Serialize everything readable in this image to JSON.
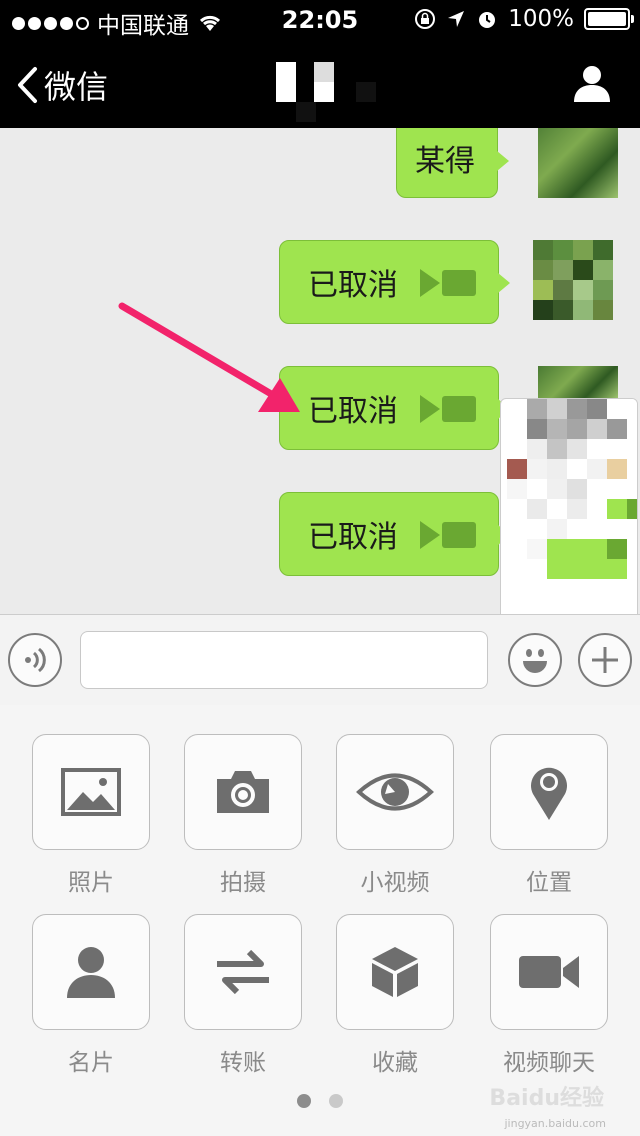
{
  "status_bar": {
    "carrier": "中国联通",
    "time": "22:05",
    "battery": "100%"
  },
  "nav": {
    "back_label": "微信",
    "icons": [
      "chevron-left-icon",
      "profile-icon"
    ]
  },
  "chat": {
    "messages": [
      {
        "text": "某得"
      },
      {
        "text": "已取消"
      },
      {
        "text": "已取消"
      },
      {
        "text": "已取消"
      }
    ]
  },
  "input_bar": {
    "icons": [
      "voice-icon",
      "emoji-icon",
      "plus-icon"
    ]
  },
  "panel": {
    "row1": [
      {
        "label": "照片",
        "icon": "photo-icon"
      },
      {
        "label": "拍摄",
        "icon": "camera-icon"
      },
      {
        "label": "小视频",
        "icon": "eye-icon"
      },
      {
        "label": "位置",
        "icon": "location-pin-icon"
      }
    ],
    "row2": [
      {
        "label": "名片",
        "icon": "person-card-icon"
      },
      {
        "label": "转账",
        "icon": "transfer-arrows-icon"
      },
      {
        "label": "收藏",
        "icon": "box-icon"
      },
      {
        "label": "视频聊天",
        "icon": "video-camera-icon"
      }
    ],
    "page_count": 2,
    "active_page": 1
  },
  "watermark": {
    "text": "Baidu经验",
    "sub": "jingyan.baidu.com"
  },
  "colors": {
    "bubble_green": "#9fe44f",
    "arrow_pink": "#f2236b",
    "chat_bg": "#ebebeb",
    "icon_gray": "#6e6e6e"
  }
}
